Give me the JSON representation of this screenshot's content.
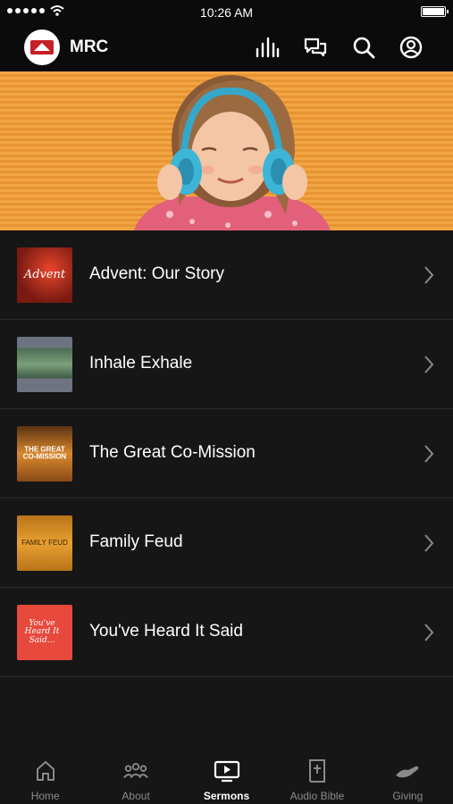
{
  "status_bar": {
    "time": "10:26 AM"
  },
  "header": {
    "title": "MRC"
  },
  "sermons": [
    {
      "title": "Advent: Our Story",
      "thumb_text": "Advent"
    },
    {
      "title": "Inhale Exhale",
      "thumb_text": ""
    },
    {
      "title": "The Great Co-Mission",
      "thumb_text": "THE GREAT CO-MISSION"
    },
    {
      "title": "Family Feud",
      "thumb_text": "FAMILY FEUD"
    },
    {
      "title": "You've Heard It Said",
      "thumb_text": "You've Heard It Said..."
    }
  ],
  "tabs": [
    {
      "label": "Home",
      "icon": "home-icon"
    },
    {
      "label": "About",
      "icon": "people-icon"
    },
    {
      "label": "Sermons",
      "icon": "play-screen-icon",
      "active": true
    },
    {
      "label": "Audio Bible",
      "icon": "bible-icon"
    },
    {
      "label": "Giving",
      "icon": "giving-hand-icon"
    }
  ],
  "colors": {
    "background": "#161616",
    "app_bar": "#0b0b0b",
    "hero_orange": "#f2a545",
    "active_tab": "#ffffff",
    "inactive_tab": "#8a8a8a"
  }
}
